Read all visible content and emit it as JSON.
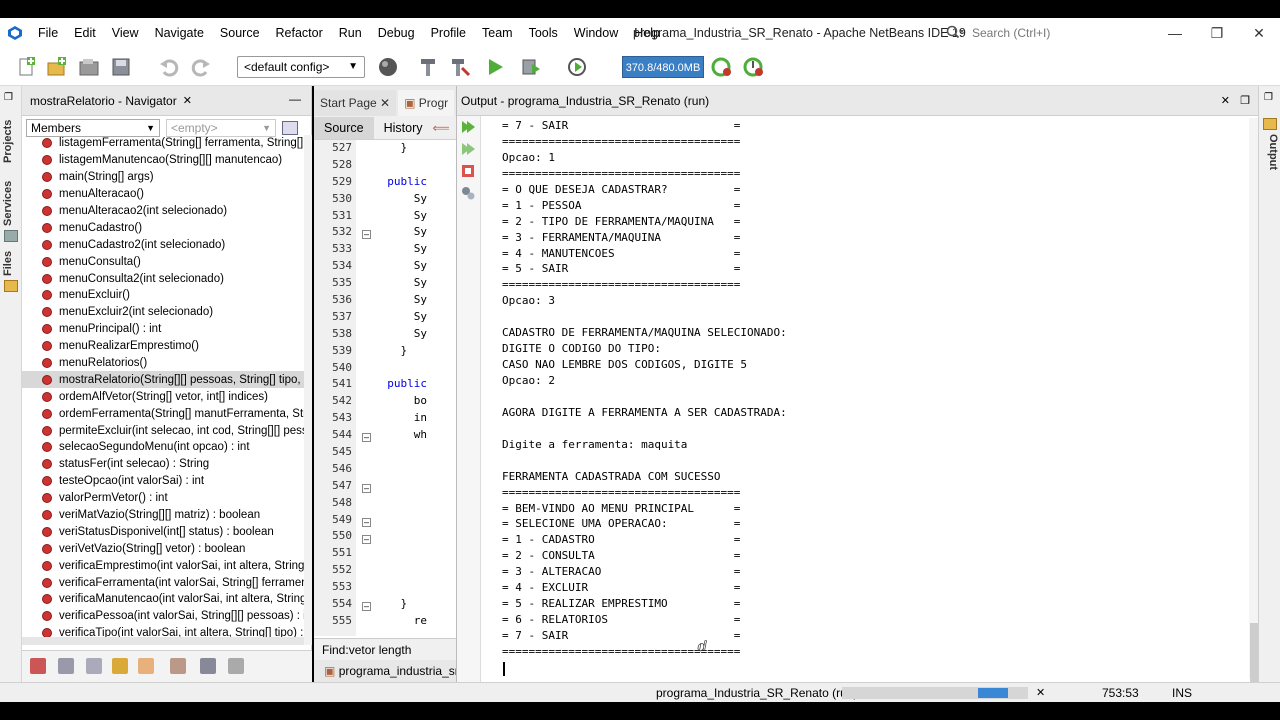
{
  "app": {
    "title": "programa_Industria_SR_Renato - Apache NetBeans IDE 19",
    "menu": [
      "File",
      "Edit",
      "View",
      "Navigate",
      "Source",
      "Refactor",
      "Run",
      "Debug",
      "Profile",
      "Team",
      "Tools",
      "Window",
      "Help"
    ],
    "search_placeholder": "Search (Ctrl+I)"
  },
  "toolbar": {
    "config": "<default config>",
    "memory": "370.8/480.0MB"
  },
  "left_strip": {
    "tabs": [
      "Projects",
      "Services",
      "Files"
    ]
  },
  "navigator": {
    "title": "mostraRelatorio - Navigator",
    "filter": "Members",
    "filter2": "<empty>",
    "members": [
      "listagemFerramenta(String[] ferramenta, String[]",
      "listagemManutencao(String[][] manutencao)",
      "main(String[] args)",
      "menuAlteracao()",
      "menuAlteracao2(int selecionado)",
      "menuCadastro()",
      "menuCadastro2(int selecionado)",
      "menuConsulta()",
      "menuConsulta2(int selecionado)",
      "menuExcluir()",
      "menuExcluir2(int selecionado)",
      "menuPrincipal() : int",
      "menuRealizarEmprestimo()",
      "menuRelatorios()",
      "mostraRelatorio(String[][] pessoas, String[] tipo,",
      "ordemAlfVetor(String[] vetor, int[] indices)",
      "ordemFerramenta(String[] manutFerramenta, Str",
      "permiteExcluir(int selecao, int cod, String[][] pess",
      "selecaoSegundoMenu(int opcao) : int",
      "statusFer(int selecao) : String",
      "testeOpcao(int valorSai) : int",
      "valorPermVetor() : int",
      "veriMatVazio(String[][] matriz) : boolean",
      "veriStatusDisponivel(int[] status) : boolean",
      "veriVetVazio(String[] vetor) : boolean",
      "verificaEmprestimo(int valorSai, int altera, String[",
      "verificaFerramenta(int valorSai, String[] ferramen",
      "verificaManutencao(int valorSai, int altera, String",
      "verificaPessoa(int valorSai, String[][] pessoas) : in",
      "verificaTipo(int valorSai, int altera, String[] tipo) :"
    ],
    "selected_index": 14
  },
  "editor": {
    "tabs": [
      "Start Page",
      "Progr"
    ],
    "source_label": "Source",
    "history_label": "History",
    "line_numbers": [
      "527",
      "528",
      "529",
      "530",
      "531",
      "532",
      "533",
      "534",
      "535",
      "536",
      "537",
      "538",
      "539",
      "540",
      "541",
      "542",
      "543",
      "544",
      "545",
      "546",
      "547",
      "548",
      "549",
      "550",
      "551",
      "552",
      "553",
      "554",
      "555"
    ],
    "code_lines": [
      "    }",
      "",
      "  public",
      "      Sy",
      "      Sy",
      "      Sy",
      "      Sy",
      "      Sy",
      "      Sy",
      "      Sy",
      "      Sy",
      "      Sy",
      "    }",
      "",
      "  public",
      "      bo",
      "      in",
      "      wh",
      "",
      "",
      "",
      "",
      "",
      "",
      "",
      "",
      "",
      "    }",
      "      re"
    ],
    "find_label": "Find:",
    "find_value": "vetor length",
    "bottom_tab": "programa_industria_sr_"
  },
  "output": {
    "title": "Output - programa_Industria_SR_Renato (run)",
    "lines": [
      "= 7 - SAIR                         =",
      "====================================",
      "Opcao: 1",
      "====================================",
      "= O QUE DESEJA CADASTRAR?          =",
      "= 1 - PESSOA                       =",
      "= 2 - TIPO DE FERRAMENTA/MAQUINA   =",
      "= 3 - FERRAMENTA/MAQUINA           =",
      "= 4 - MANUTENCOES                  =",
      "= 5 - SAIR                         =",
      "====================================",
      "Opcao: 3",
      "",
      "CADASTRO DE FERRAMENTA/MAQUINA SELECIONADO:",
      "DIGITE O CODIGO DO TIPO:",
      "CASO NAO LEMBRE DOS CODIGOS, DIGITE 5",
      "Opcao: 2",
      "",
      "AGORA DIGITE A FERRAMENTA A SER CADASTRADA:",
      "",
      "Digite a ferramenta: maquita",
      "",
      "FERRAMENTA CADASTRADA COM SUCESSO",
      "====================================",
      "= BEM-VINDO AO MENU PRINCIPAL      =",
      "= SELECIONE UMA OPERACAO:          =",
      "= 1 - CADASTRO                     =",
      "= 2 - CONSULTA                     =",
      "= 3 - ALTERACAO                    =",
      "= 4 - EXCLUIR                      =",
      "= 5 - REALIZAR EMPRESTIMO          =",
      "= 6 - RELATORIOS                   =",
      "= 7 - SAIR                         =",
      "===================================="
    ]
  },
  "right_strip": {
    "tab": "Output"
  },
  "status": {
    "task": "programa_Industria_SR_Renato (run)",
    "position": "753:53",
    "mode": "INS"
  }
}
